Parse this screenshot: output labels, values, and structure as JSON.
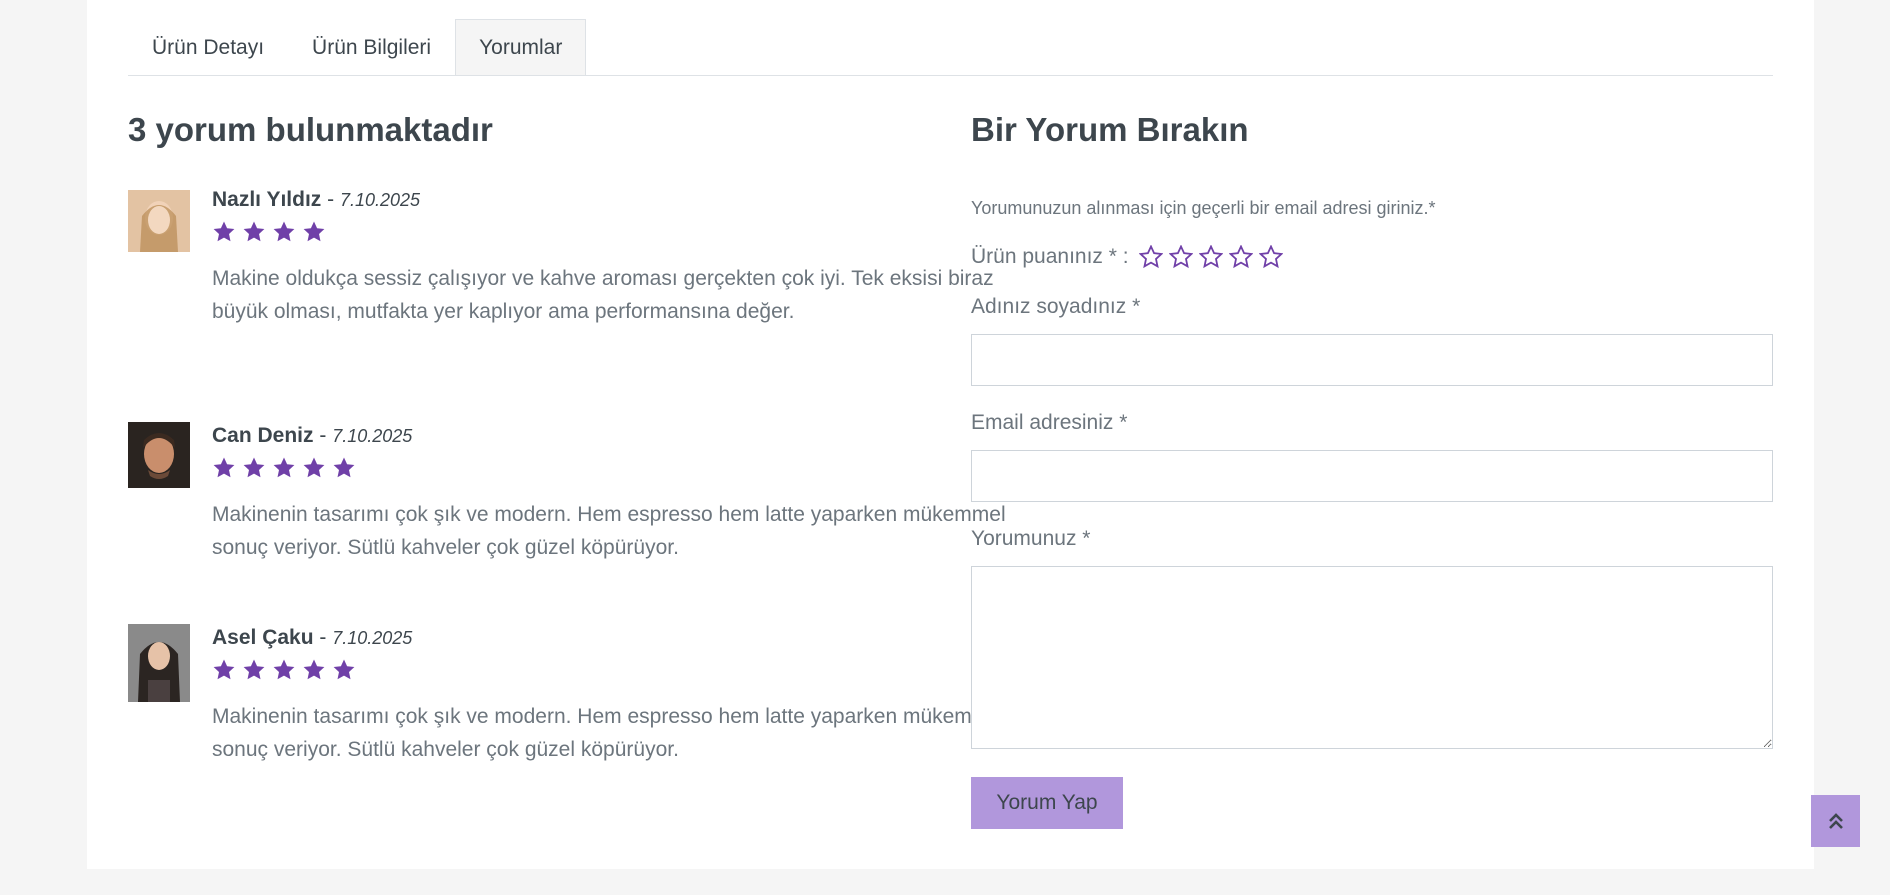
{
  "tabs": [
    {
      "label": "Ürün Detayı"
    },
    {
      "label": "Ürün Bilgileri"
    },
    {
      "label": "Yorumlar"
    }
  ],
  "reviews_heading": "3 yorum bulunmaktadır",
  "reviews": [
    {
      "name": "Nazlı Yıldız",
      "date": "7.10.2025",
      "rating": 4,
      "text": "Makine oldukça sessiz çalışıyor ve kahve aroması gerçekten çok iyi. Tek eksisi biraz büyük olması, mutfakta yer kaplıyor ama performansına değer."
    },
    {
      "name": "Can Deniz",
      "date": "7.10.2025",
      "rating": 5,
      "text": "Makinenin tasarımı çok şık ve modern. Hem espresso hem latte yaparken mükemmel sonuç veriyor. Sütlü kahveler çok güzel köpürüyor."
    },
    {
      "name": "Asel Çaku",
      "date": "7.10.2025",
      "rating": 5,
      "text": "Makinenin tasarımı çok şık ve modern. Hem espresso hem latte yaparken mükemmel sonuç veriyor. Sütlü kahveler çok güzel köpürüyor."
    }
  ],
  "form": {
    "heading": "Bir Yorum Bırakın",
    "note": "Yorumunuzun alınması için geçerli bir email adresi giriniz.*",
    "rating_label": "Ürün puanınız * :",
    "name_label": "Adınız soyadınız *",
    "name_value": "",
    "email_label": "Email adresiniz *",
    "email_value": "",
    "comment_label": "Yorumunuz *",
    "comment_value": "",
    "submit_label": "Yorum Yap"
  },
  "colors": {
    "accent": "#b197dc",
    "star": "#7040a8",
    "text": "#3d464d",
    "muted": "#6c757d"
  },
  "icons": {
    "filled_star": "star-icon",
    "empty_star": "star-outline-icon",
    "scroll_top": "double-chevron-up-icon"
  }
}
